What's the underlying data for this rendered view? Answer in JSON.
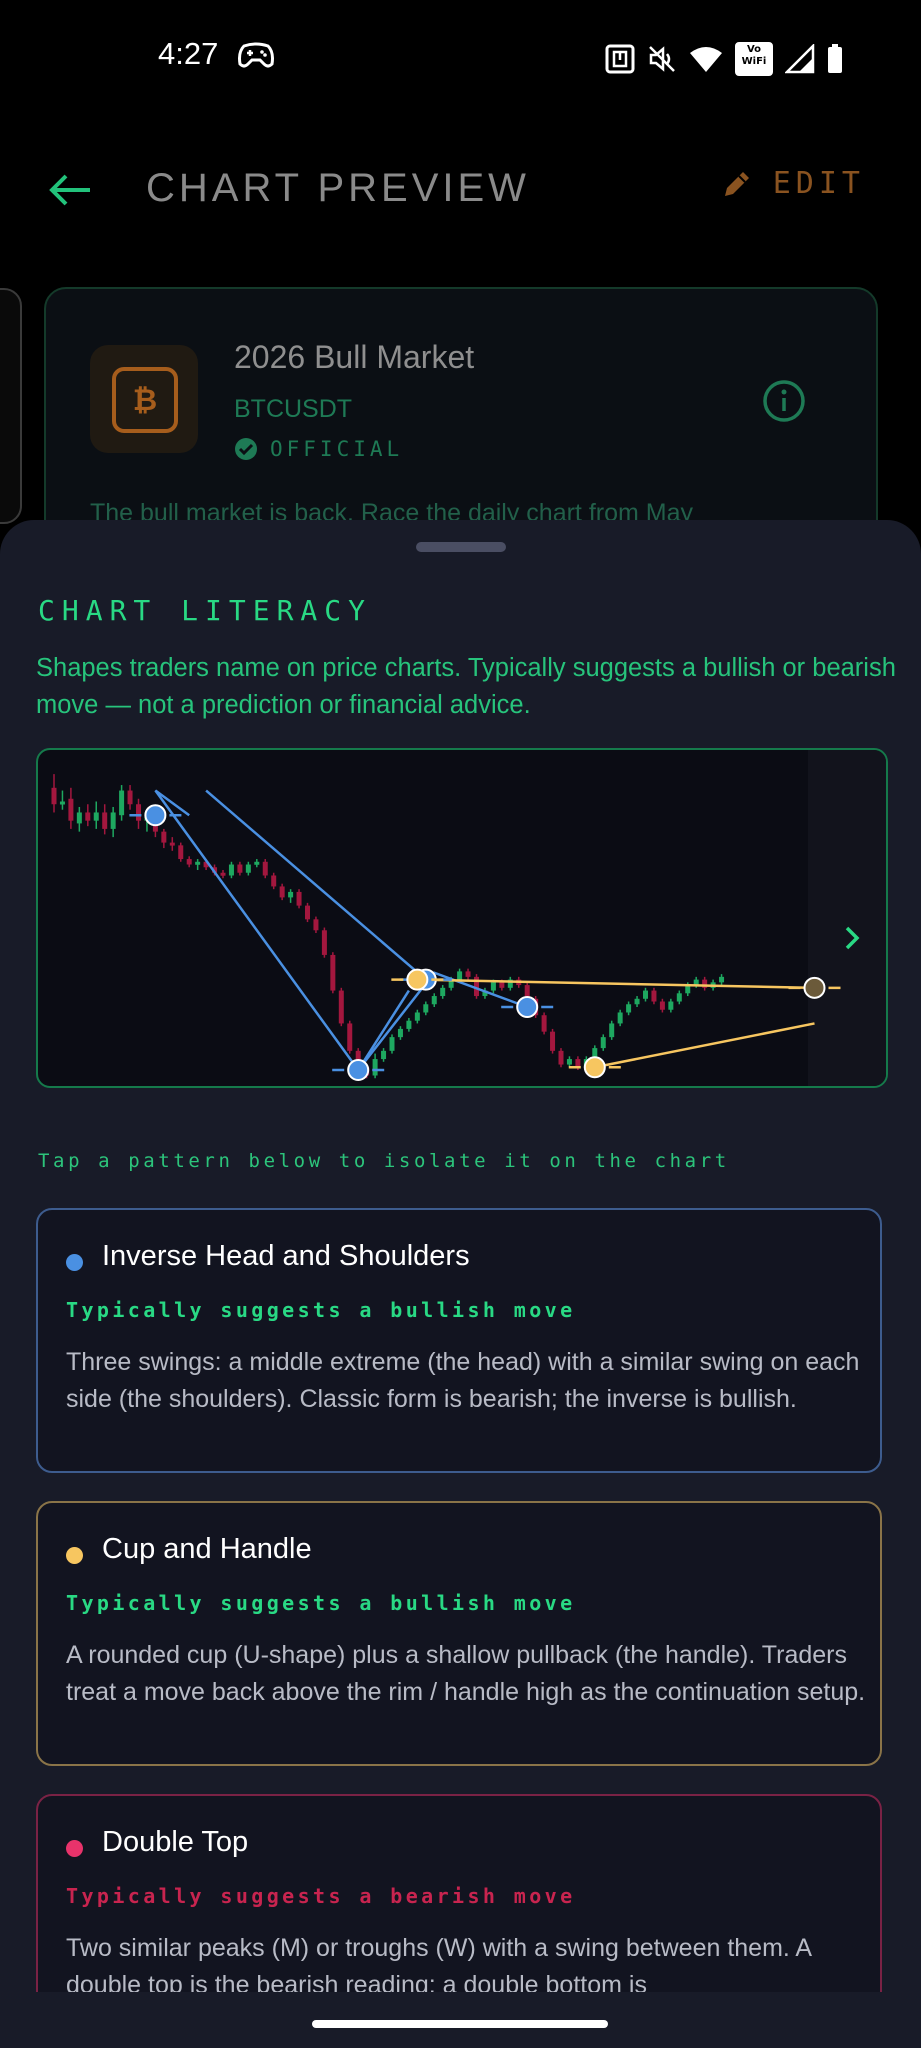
{
  "status_bar": {
    "time": "4:27",
    "wifi_calling_label": "Vo\nWiFi"
  },
  "header": {
    "title": "CHART PREVIEW",
    "edit_label": "EDIT"
  },
  "market_card": {
    "title": "2026 Bull Market",
    "symbol": "BTCUSDT",
    "official_label": "OFFICIAL",
    "description": "The bull market is back. Race the daily chart from May"
  },
  "sheet": {
    "title": "CHART LITERACY",
    "subtitle": "Shapes traders name on price charts. Typically suggests a bullish or bearish move — not a prediction or financial advice.",
    "chart_hint": "Tap a pattern below to isolate it on the chart"
  },
  "patterns": [
    {
      "name": "Inverse Head and Shoulders",
      "bias": "Typically suggests a bullish move",
      "description": "Three swings: a middle extreme (the head) with a similar swing on each side (the shoulders). Classic form is bearish; the inverse is bullish.",
      "color": "#4a90e2",
      "bias_color": "#29d984"
    },
    {
      "name": "Cup and Handle",
      "bias": "Typically suggests a bullish move",
      "description": "A rounded cup (U-shape) plus a shallow pullback (the handle). Traders treat a move back above the rim / handle high as the continuation setup.",
      "color": "#f7c660",
      "bias_color": "#29d984"
    },
    {
      "name": "Double Top",
      "bias": "Typically suggests a bearish move",
      "description": "Two similar peaks (M) or troughs (W) with a swing between them. A double top is the bearish reading; a double bottom is",
      "color": "#e8336b",
      "bias_color": "#c8244f"
    }
  ],
  "colors": {
    "accent": "#29d984",
    "edit": "#8a5320",
    "bull_candle": "#1ea860",
    "bear_candle": "#a3173e",
    "sheet_bg": "#181b28"
  },
  "chart_data": {
    "type": "candlestick",
    "candles": [
      [
        60,
        48,
        70,
        42
      ],
      [
        48,
        50,
        58,
        44
      ],
      [
        52,
        36,
        60,
        30
      ],
      [
        34,
        42,
        46,
        28
      ],
      [
        42,
        36,
        48,
        32
      ],
      [
        36,
        42,
        50,
        30
      ],
      [
        42,
        30,
        48,
        26
      ],
      [
        30,
        42,
        46,
        24
      ],
      [
        40,
        58,
        62,
        36
      ],
      [
        58,
        48,
        62,
        44
      ],
      [
        48,
        36,
        52,
        30
      ],
      [
        36,
        42,
        44,
        28
      ],
      [
        42,
        28,
        46,
        24
      ],
      [
        28,
        20,
        30,
        16
      ],
      [
        20,
        18,
        24,
        14
      ],
      [
        18,
        8,
        20,
        6
      ],
      [
        8,
        4,
        10,
        2
      ],
      [
        4,
        6,
        8,
        0
      ],
      [
        6,
        2,
        8,
        0
      ],
      [
        2,
        -2,
        4,
        -4
      ],
      [
        -2,
        -4,
        0,
        -6
      ],
      [
        -4,
        4,
        6,
        -6
      ],
      [
        4,
        -2,
        6,
        -4
      ],
      [
        -2,
        4,
        6,
        -4
      ],
      [
        4,
        6,
        8,
        2
      ],
      [
        6,
        -4,
        8,
        -6
      ],
      [
        -4,
        -12,
        -2,
        -14
      ],
      [
        -12,
        -20,
        -10,
        -22
      ],
      [
        -20,
        -16,
        -14,
        -24
      ],
      [
        -16,
        -26,
        -14,
        -28
      ],
      [
        -26,
        -36,
        -24,
        -38
      ],
      [
        -36,
        -44,
        -34,
        -46
      ],
      [
        -44,
        -62,
        -42,
        -64
      ],
      [
        -62,
        -88,
        -60,
        -90
      ],
      [
        -88,
        -112,
        -86,
        -114
      ],
      [
        -112,
        -132,
        -110,
        -134
      ],
      [
        -132,
        -144,
        -130,
        -146
      ],
      [
        -144,
        -150,
        -142,
        -152
      ],
      [
        -150,
        -138,
        -134,
        -152
      ],
      [
        -138,
        -132,
        -130,
        -140
      ],
      [
        -132,
        -122,
        -120,
        -134
      ],
      [
        -122,
        -116,
        -114,
        -124
      ],
      [
        -116,
        -110,
        -108,
        -118
      ],
      [
        -110,
        -104,
        -102,
        -112
      ],
      [
        -104,
        -98,
        -96,
        -106
      ],
      [
        -98,
        -92,
        -90,
        -100
      ],
      [
        -92,
        -86,
        -84,
        -94
      ],
      [
        -86,
        -80,
        -78,
        -88
      ],
      [
        -80,
        -74,
        -72,
        -82
      ],
      [
        -74,
        -78,
        -72,
        -80
      ],
      [
        -78,
        -92,
        -76,
        -94
      ],
      [
        -92,
        -88,
        -86,
        -94
      ],
      [
        -88,
        -82,
        -80,
        -90
      ],
      [
        -82,
        -86,
        -80,
        -88
      ],
      [
        -86,
        -80,
        -78,
        -88
      ],
      [
        -80,
        -84,
        -78,
        -86
      ],
      [
        -84,
        -94,
        -82,
        -96
      ],
      [
        -94,
        -106,
        -92,
        -108
      ],
      [
        -106,
        -118,
        -104,
        -120
      ],
      [
        -118,
        -132,
        -116,
        -134
      ],
      [
        -132,
        -142,
        -130,
        -144
      ],
      [
        -142,
        -138,
        -136,
        -144
      ],
      [
        -138,
        -144,
        -136,
        -146
      ],
      [
        -144,
        -138,
        -136,
        -146
      ],
      [
        -138,
        -130,
        -128,
        -140
      ],
      [
        -130,
        -122,
        -120,
        -132
      ],
      [
        -122,
        -112,
        -110,
        -124
      ],
      [
        -112,
        -104,
        -102,
        -114
      ],
      [
        -104,
        -98,
        -96,
        -106
      ],
      [
        -98,
        -94,
        -92,
        -100
      ],
      [
        -94,
        -88,
        -86,
        -96
      ],
      [
        -88,
        -96,
        -86,
        -98
      ],
      [
        -96,
        -102,
        -94,
        -104
      ],
      [
        -102,
        -96,
        -94,
        -104
      ],
      [
        -96,
        -90,
        -88,
        -98
      ],
      [
        -90,
        -84,
        -82,
        -92
      ],
      [
        -84,
        -80,
        -78,
        -86
      ],
      [
        -80,
        -86,
        -78,
        -88
      ],
      [
        -86,
        -82,
        -80,
        -88
      ],
      [
        -82,
        -78,
        -76,
        -84
      ]
    ],
    "overlays": {
      "inverse_head_and_shoulders": {
        "pivots": [
          [
            12,
            58
          ],
          [
            16,
            40
          ],
          [
            33,
            -112
          ],
          [
            36,
            -146
          ],
          [
            42,
            -120
          ],
          [
            48,
            -80
          ],
          [
            56,
            -100
          ]
        ],
        "markers": [
          [
            12,
            40
          ],
          [
            36,
            -146
          ],
          [
            44,
            -80
          ],
          [
            56,
            -100
          ]
        ]
      },
      "cup_and_handle": {
        "rim": [
          [
            43,
            -80
          ],
          [
            90,
            -86
          ]
        ],
        "base": [
          [
            64,
            -144
          ],
          [
            90,
            -112
          ]
        ],
        "markers": [
          [
            43,
            -80
          ],
          [
            64,
            -144
          ],
          [
            90,
            -86
          ]
        ]
      }
    }
  }
}
